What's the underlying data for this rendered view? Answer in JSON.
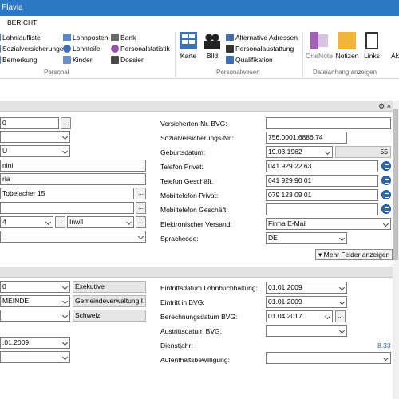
{
  "window": {
    "title": "Flavia"
  },
  "ribbon_tab": "BERICHT",
  "ribbon": {
    "personal_items": [
      {
        "label": "Lohnlaufliste",
        "icon": "list-icon"
      },
      {
        "label": "Sozialversicherungen",
        "icon": "insurance-icon"
      },
      {
        "label": "Bemerkung",
        "icon": "note-icon"
      },
      {
        "label": "Lohnposten",
        "icon": "salary-items-icon"
      },
      {
        "label": "Lohnteile",
        "icon": "salary-parts-icon"
      },
      {
        "label": "Kinder",
        "icon": "children-icon"
      },
      {
        "label": "Bank",
        "icon": "bank-icon"
      },
      {
        "label": "Personalstatistik",
        "icon": "statistics-icon"
      },
      {
        "label": "Dossier",
        "icon": "dossier-icon"
      }
    ],
    "personal_group": "Personal",
    "personalwesen_big": [
      {
        "label": "Karte",
        "icon": "card-icon"
      },
      {
        "label": "Bild",
        "icon": "picture-icon"
      }
    ],
    "personalwesen_items": [
      {
        "label": "Alternative Adressen",
        "icon": "addresses-icon"
      },
      {
        "label": "Personalaustattung",
        "icon": "equipment-icon"
      },
      {
        "label": "Qualifikation",
        "icon": "qualification-icon"
      }
    ],
    "personalwesen_group": "Personalwesen",
    "anhang_big": [
      {
        "label": "OneNote",
        "icon": "onenote-icon"
      },
      {
        "label": "Notizen",
        "icon": "notes-icon"
      },
      {
        "label": "Links",
        "icon": "links-icon"
      },
      {
        "label": "Ak",
        "icon": "more-icon"
      }
    ],
    "anhang_group": "Dateianhang anzeigen"
  },
  "section1": {
    "left": {
      "field1": "0",
      "field4": "U",
      "field5": "nini",
      "field6": "ria",
      "street": "Tobelacher 15",
      "zip": "4",
      "city": "Inwil"
    },
    "right": [
      {
        "label": "Versicherten-Nr. BVG:",
        "value": ""
      },
      {
        "label": "Sozialversicherungs-Nr.:",
        "value": "756.0001.6886.74"
      },
      {
        "label": "Geburtsdatum:",
        "value": "19.03.1962",
        "extra": "55"
      },
      {
        "label": "Telefon Privat:",
        "value": "041 929 22 63"
      },
      {
        "label": "Telefon Geschäft:",
        "value": "041 929 90 01"
      },
      {
        "label": "Mobiltelefon Privat:",
        "value": "079 123 09 01"
      },
      {
        "label": "Mobiltelefon Geschäft:",
        "value": ""
      },
      {
        "label": "Elektronischer Versand:",
        "value": "Firma E-Mail"
      },
      {
        "label": "Sprachcode:",
        "value": "DE"
      }
    ],
    "more_button": "Mehr Felder anzeigen"
  },
  "section2": {
    "left": {
      "row1_value": "0",
      "row1_gray": "Exekutive",
      "row2_value": "MEINDE",
      "row2_gray": "Gemeindeverwaltung I...",
      "row3_gray": "Schweiz",
      "date": ".01.2009"
    },
    "right": [
      {
        "label": "Eintrittsdatum Lohnbuchhaltung:",
        "value": "01.01.2009"
      },
      {
        "label": "Eintritt in BVG:",
        "value": "01.01.2009"
      },
      {
        "label": "Berechnungsdatum BVG:",
        "value": "01.04.2017"
      },
      {
        "label": "Austrittsdatum BVG:",
        "value": ""
      },
      {
        "label": "Dienstjahr:",
        "value": "8.33"
      },
      {
        "label": "Aufenthaltsbewilligung:",
        "value": ""
      }
    ]
  },
  "colors": {
    "titlebar": "#2b78c5",
    "link": "#1a5fb4",
    "section_header": "#e3e3e3"
  }
}
